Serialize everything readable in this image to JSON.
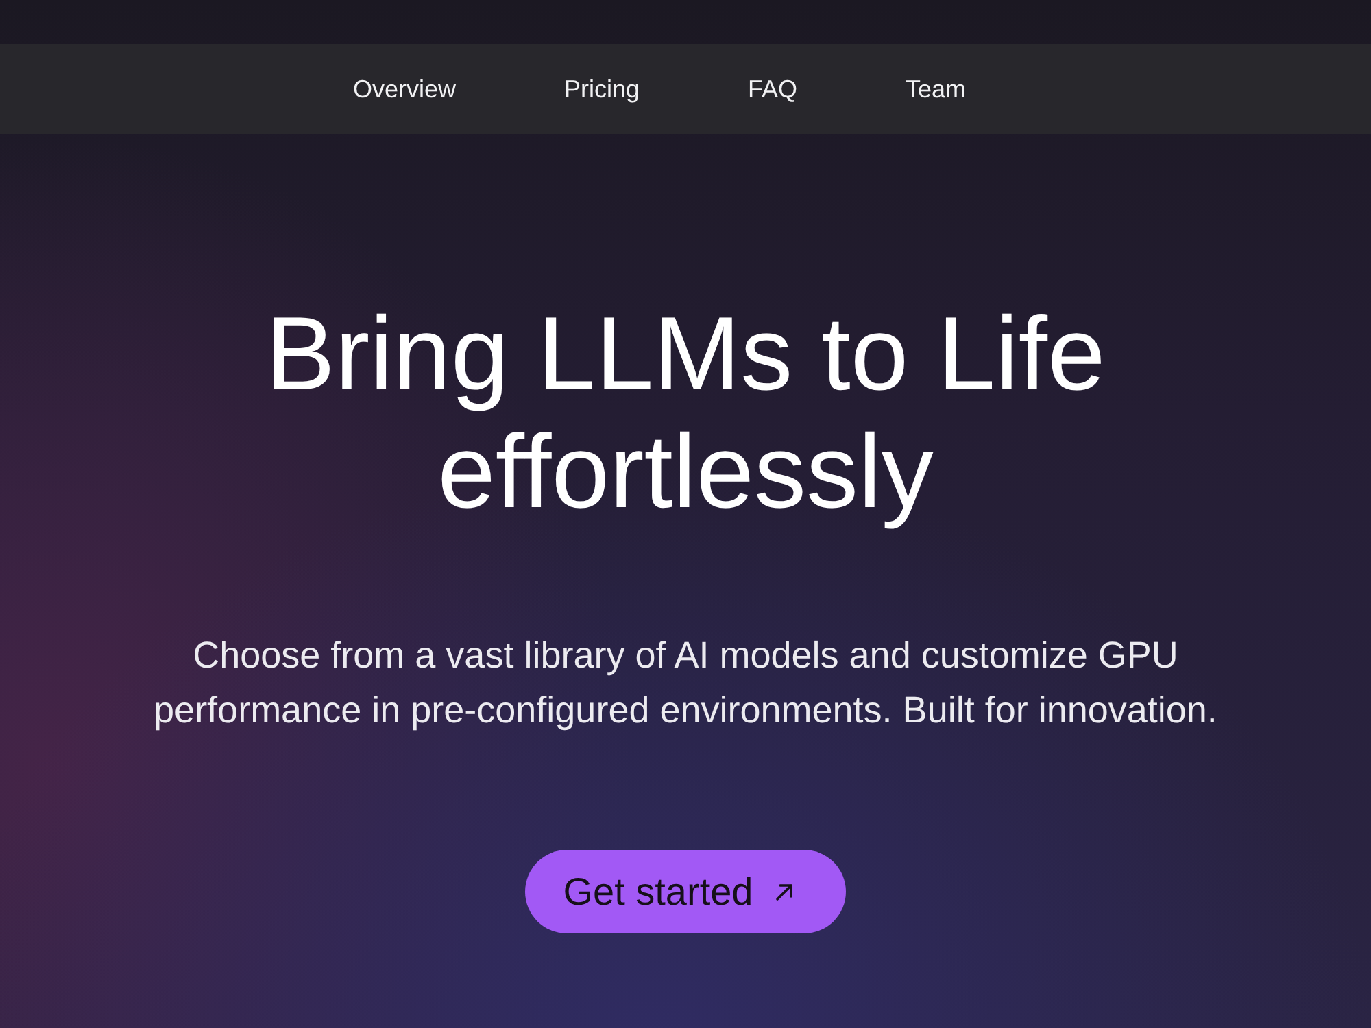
{
  "nav": {
    "items": [
      {
        "label": "Overview"
      },
      {
        "label": "Pricing"
      },
      {
        "label": "FAQ"
      },
      {
        "label": "Team"
      }
    ]
  },
  "hero": {
    "title_lines": [
      "Bring LLMs to Life",
      "effortlessly"
    ],
    "subtitle": "Choose from a vast library of AI models and customize GPU performance in pre-configured environments. Built for innovation.",
    "cta": {
      "label": "Get started"
    }
  }
}
